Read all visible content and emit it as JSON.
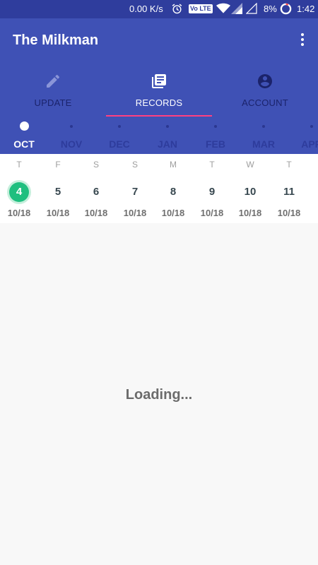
{
  "status_bar": {
    "net_speed": "0.00 K/s",
    "volte": "Vo LTE",
    "battery": "8%",
    "time": "1:42"
  },
  "app_bar": {
    "title": "The Milkman"
  },
  "tabs": [
    {
      "label": "UPDATE",
      "icon": "pencil-icon",
      "active": false
    },
    {
      "label": "RECORDS",
      "icon": "records-icon",
      "active": true
    },
    {
      "label": "ACCOUNT",
      "icon": "account-icon",
      "active": false
    }
  ],
  "months": [
    {
      "label": "OCT",
      "active": true
    },
    {
      "label": "NOV"
    },
    {
      "label": "DEC"
    },
    {
      "label": "JAN"
    },
    {
      "label": "FEB"
    },
    {
      "label": "MAR"
    },
    {
      "label": "APR"
    }
  ],
  "days": [
    {
      "weekday": "T",
      "day": "4",
      "month_year": "10/18",
      "selected": true
    },
    {
      "weekday": "F",
      "day": "5",
      "month_year": "10/18"
    },
    {
      "weekday": "S",
      "day": "6",
      "month_year": "10/18"
    },
    {
      "weekday": "S",
      "day": "7",
      "month_year": "10/18"
    },
    {
      "weekday": "M",
      "day": "8",
      "month_year": "10/18"
    },
    {
      "weekday": "T",
      "day": "9",
      "month_year": "10/18"
    },
    {
      "weekday": "W",
      "day": "10",
      "month_year": "10/18"
    },
    {
      "weekday": "T",
      "day": "11",
      "month_year": "10/18"
    }
  ],
  "content": {
    "loading_text": "Loading..."
  },
  "colors": {
    "primary": "#3f51b5",
    "status_bar": "#2f3d9d",
    "accent": "#ff4081",
    "selected_day": "#1fbf7f"
  }
}
